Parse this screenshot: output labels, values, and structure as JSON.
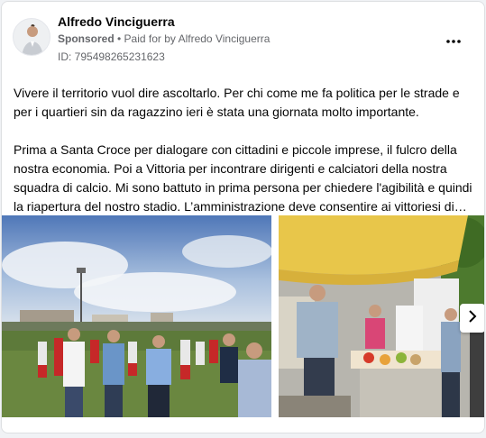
{
  "post": {
    "author_name": "Alfredo Vinciguerra",
    "sponsored_label": "Sponsored",
    "separator": " • ",
    "paid_by_text": "Paid for by Alfredo Vinciguerra",
    "ad_id": "ID: 795498265231623",
    "more_icon": "more-horizontal-icon",
    "paragraph_1": "Vivere il territorio vuol dire ascoltarlo. Per chi come me fa politica per le strade e per i quartieri sin da ragazzino ieri è stata una giornata molto importante.",
    "paragraph_2": "Prima a Santa Croce per dialogare con cittadini e piccole imprese, il fulcro della nostra economia. Poi a Vittoria per incontrare dirigenti e calciatori della nostra squadra di calcio. Mi sono battuto in prima persona per chiedere l'agibilità e quindi la riapertura del nostro stadio. L’amministrazione deve consentire ai vittoriesi di…"
  },
  "media": {
    "photos": [
      {
        "name": "football-team-photo"
      },
      {
        "name": "market-stall-photo"
      }
    ],
    "next_icon": "chevron-right-icon"
  },
  "colors": {
    "secondary_text": "#65676b",
    "card_border": "#dddfe2",
    "background": "#f0f2f5"
  }
}
